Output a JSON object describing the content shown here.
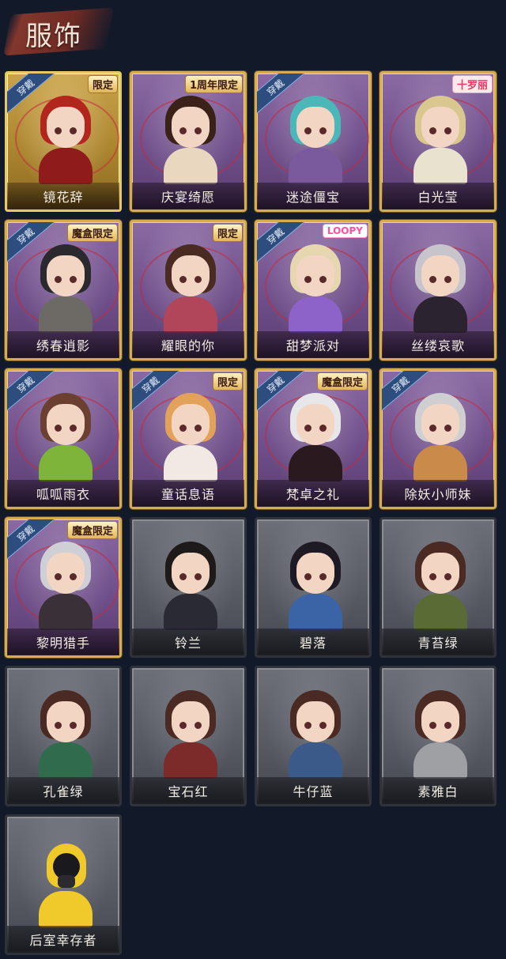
{
  "header": {
    "title": "服饰"
  },
  "badges": {
    "wearing": "穿戴"
  },
  "costumes": [
    {
      "name": "镜花辞",
      "tier": "legend",
      "wearing": true,
      "tag": "限定",
      "tag_style": "gold",
      "hair": "#b3261e",
      "cloth": "#8f1b1b"
    },
    {
      "name": "庆宴绮愿",
      "tier": "epic",
      "wearing": false,
      "tag": "1周年限定",
      "tag_style": "gold",
      "hair": "#3a2218",
      "cloth": "#e9d7bf"
    },
    {
      "name": "迷途僵宝",
      "tier": "epic",
      "wearing": true,
      "tag": "",
      "tag_style": "",
      "hair": "#4cb7b8",
      "cloth": "#7a5a9c"
    },
    {
      "name": "白光莹",
      "tier": "epic",
      "wearing": false,
      "tag": "十罗丽",
      "tag_style": "pink",
      "hair": "#d8c78e",
      "cloth": "#e9e2cf"
    },
    {
      "name": "绣春逍影",
      "tier": "epic",
      "wearing": true,
      "tag": "魔盒限定",
      "tag_style": "gold",
      "hair": "#2a2a2e",
      "cloth": "#6d6a66"
    },
    {
      "name": "耀眼的你",
      "tier": "epic",
      "wearing": false,
      "tag": "限定",
      "tag_style": "gold",
      "hair": "#4a2b22",
      "cloth": "#b1455a"
    },
    {
      "name": "甜梦派对",
      "tier": "epic",
      "wearing": true,
      "tag": "LOOPY",
      "tag_style": "loopy",
      "hair": "#e7d7b0",
      "cloth": "#8e63c9"
    },
    {
      "name": "丝缕哀歌",
      "tier": "epic",
      "wearing": false,
      "tag": "",
      "tag_style": "",
      "hair": "#c7c4cc",
      "cloth": "#2b2430"
    },
    {
      "name": "呱呱雨衣",
      "tier": "epic",
      "wearing": true,
      "tag": "",
      "tag_style": "",
      "hair": "#6b4030",
      "cloth": "#7fb43a"
    },
    {
      "name": "童话息语",
      "tier": "epic",
      "wearing": true,
      "tag": "限定",
      "tag_style": "gold",
      "hair": "#e3a25a",
      "cloth": "#f2e9e4"
    },
    {
      "name": "梵卓之礼",
      "tier": "epic",
      "wearing": true,
      "tag": "魔盒限定",
      "tag_style": "gold",
      "hair": "#e7e7ea",
      "cloth": "#2a1a20"
    },
    {
      "name": "除妖小师妹",
      "tier": "epic",
      "wearing": true,
      "tag": "",
      "tag_style": "",
      "hair": "#cfcfd2",
      "cloth": "#c98a4a"
    },
    {
      "name": "黎明猎手",
      "tier": "epic",
      "wearing": true,
      "tag": "魔盒限定",
      "tag_style": "gold",
      "hair": "#cfcfd6",
      "cloth": "#3a3038"
    },
    {
      "name": "铃兰",
      "tier": "plain",
      "wearing": false,
      "tag": "",
      "tag_style": "",
      "hair": "#1e1a1a",
      "cloth": "#2a2a35"
    },
    {
      "name": "碧落",
      "tier": "plain",
      "wearing": false,
      "tag": "",
      "tag_style": "",
      "hair": "#1e1a24",
      "cloth": "#3b64a6"
    },
    {
      "name": "青苔绿",
      "tier": "plain",
      "wearing": false,
      "tag": "",
      "tag_style": "",
      "hair": "#4a2a22",
      "cloth": "#5a6b35"
    },
    {
      "name": "孔雀绿",
      "tier": "plain",
      "wearing": false,
      "tag": "",
      "tag_style": "",
      "hair": "#4a2a22",
      "cloth": "#2f6b4c"
    },
    {
      "name": "宝石红",
      "tier": "plain",
      "wearing": false,
      "tag": "",
      "tag_style": "",
      "hair": "#4a2a22",
      "cloth": "#7d2a2a"
    },
    {
      "name": "牛仔蓝",
      "tier": "plain",
      "wearing": false,
      "tag": "",
      "tag_style": "",
      "hair": "#4a2a22",
      "cloth": "#3b5a8a"
    },
    {
      "name": "素雅白",
      "tier": "plain",
      "wearing": false,
      "tag": "",
      "tag_style": "",
      "hair": "#4a2a22",
      "cloth": "#9ea0a4"
    },
    {
      "name": "后室幸存者",
      "tier": "plain",
      "wearing": false,
      "tag": "",
      "tag_style": "",
      "hair": "#f0c92a",
      "cloth": "#f0c92a",
      "gasmask": true
    }
  ]
}
